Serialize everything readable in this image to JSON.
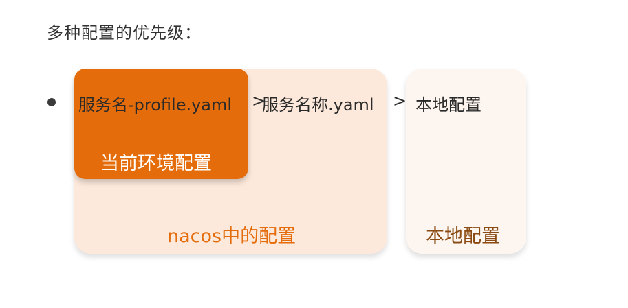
{
  "title": "多种配置的优先级：",
  "panels": {
    "profile": {
      "file": "服务名-profile.yaml",
      "label": "当前环境配置"
    },
    "nacos": {
      "file": "服务名称.yaml",
      "label": "nacos中的配置"
    },
    "local": {
      "file": "本地配置",
      "label": "本地配置"
    }
  },
  "separator": ">",
  "colors": {
    "profile_fill": "#e46c0a",
    "nacos_fill": "#fde9db",
    "local_fill": "#fdf6f0",
    "nacos_label": "#e46c0a",
    "local_label": "#8a4a12"
  }
}
